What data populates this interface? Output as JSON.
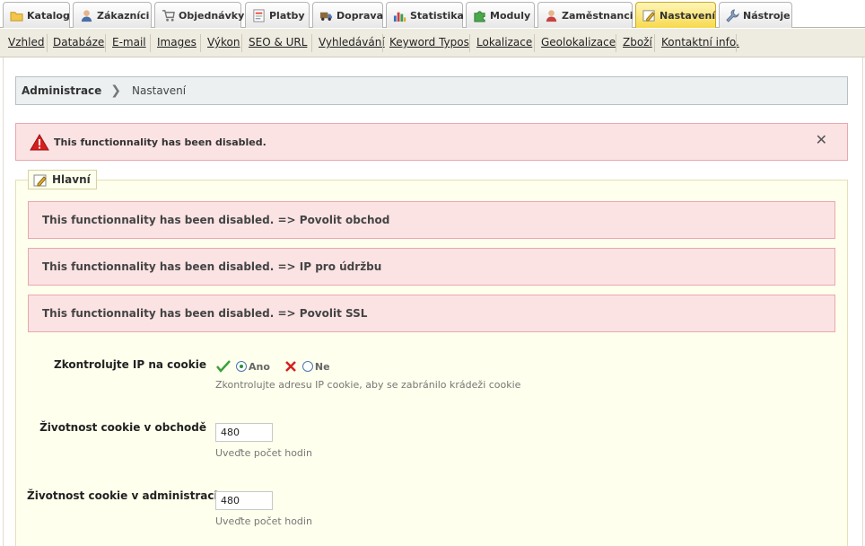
{
  "tabs": [
    {
      "label": "Katalog",
      "icon": "folder-icon"
    },
    {
      "label": "Zákazníci",
      "icon": "user-icon"
    },
    {
      "label": "Objednávky",
      "icon": "cart-icon"
    },
    {
      "label": "Platby",
      "icon": "invoice-icon"
    },
    {
      "label": "Doprava",
      "icon": "truck-icon"
    },
    {
      "label": "Statistika",
      "icon": "chart-icon"
    },
    {
      "label": "Moduly",
      "icon": "puzzle-icon"
    },
    {
      "label": "Zaměstnanci",
      "icon": "employee-icon"
    },
    {
      "label": "Nastavení",
      "icon": "settings-icon",
      "active": true
    },
    {
      "label": "Nástroje",
      "icon": "wrench-icon"
    }
  ],
  "submenu": [
    "Vzhled",
    "Databáze",
    "E-mail",
    "Images",
    "Výkon",
    "SEO & URL",
    "Vyhledávání",
    "Keyword Typos",
    "Lokalizace",
    "Geolokalizace",
    "Zboží",
    "Kontaktní info."
  ],
  "breadcrumb": {
    "root": "Administrace",
    "current": "Nastavení"
  },
  "alert": {
    "text": "This functionnality has been disabled.",
    "close": "✕"
  },
  "section": {
    "legend": "Hlavní"
  },
  "disabled_rows": [
    "This functionnality has been disabled. => Povolit obchod",
    "This functionnality has been disabled. => IP pro údržbu",
    "This functionnality has been disabled. => Povolit SSL"
  ],
  "fields": {
    "check_ip": {
      "label": "Zkontrolujte IP na cookie",
      "yes": "Ano",
      "no": "Ne",
      "selected": "Ano",
      "hint": "Zkontrolujte adresu IP cookie, aby se zabránilo krádeži cookie"
    },
    "cookie_shop": {
      "label": "Životnost cookie v obchodě",
      "value": "480",
      "hint": "Uveďte počet hodin"
    },
    "cookie_admin": {
      "label": "Životnost cookie v administraci",
      "value": "480",
      "hint": "Uveďte počet hodin"
    }
  },
  "colors": {
    "active_tab": "#f7d94d",
    "error_bg": "#fbe3e4",
    "error_border": "#e8a9ad",
    "fieldset_bg": "#ffffed"
  }
}
